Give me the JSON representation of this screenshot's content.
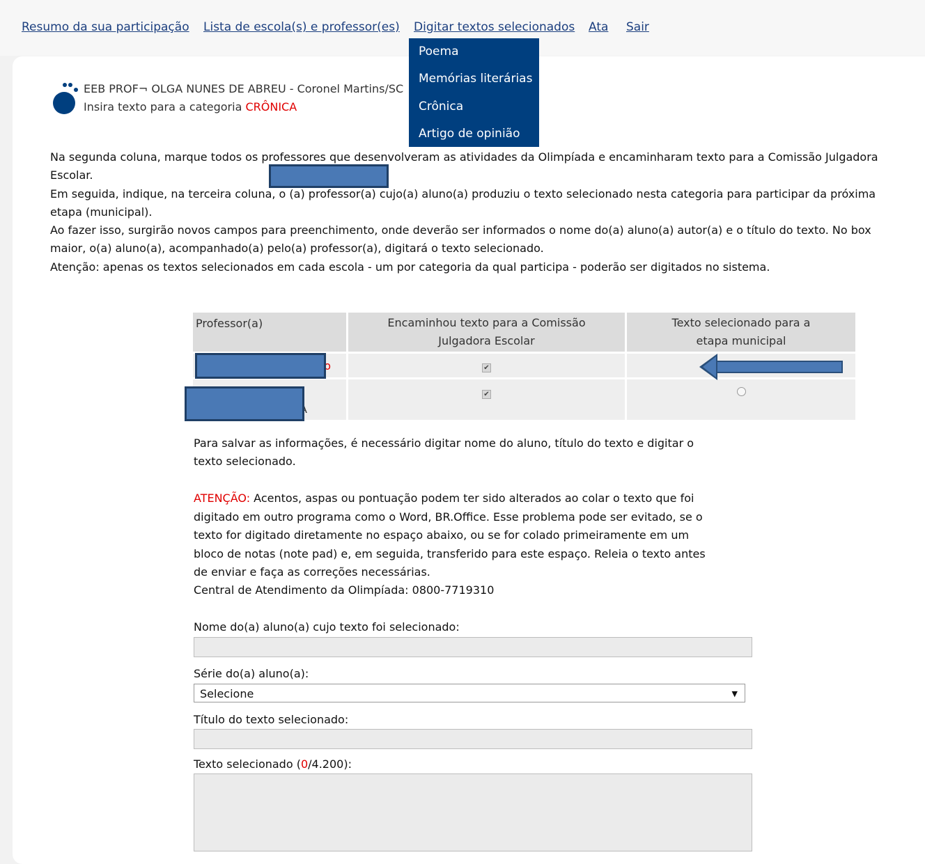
{
  "nav": {
    "items": [
      "Resumo da sua participação",
      "Lista de escola(s) e professor(es)",
      "Digitar textos selecionados",
      "Ata",
      "Sair"
    ]
  },
  "dropdown": {
    "items": [
      "Poema",
      "Memórias literárias",
      "Crônica",
      "Artigo de opinião"
    ]
  },
  "school": {
    "name": "EEB PROF¬ OLGA NUNES DE ABREU - Coronel Martins/SC",
    "insert_prefix": "Insira texto para a categoria",
    "category": "CRÔNICA"
  },
  "instructions": [
    "Na segunda coluna, marque todos os professores que desenvolveram as atividades da Olimpíada e encaminharam texto para a Comissão Julgadora",
    "Escolar.",
    "Em seguida, indique, na terceira coluna, o (a) professor(a) cujo(a) aluno(a) produziu o texto selecionado nesta categoria para participar da próxima",
    "etapa (municipal).",
    "Ao fazer isso, surgirão novos campos para preenchimento, onde deverão ser informados o nome do(a) aluno(a) autor(a) e o título do texto. No box",
    "maior, o(a) aluno(a), acompanhado(a) pelo(a) professor(a), digitará o texto selecionado.",
    "Atenção: apenas os textos selecionados em cada escola - um por categoria da qual participa - poderão ser digitados no sistema."
  ],
  "table": {
    "headers": [
      "Professor(a)",
      "Encaminhou texto para a Comissão Julgadora Escolar",
      "Texto selecionado para a etapa municipal"
    ],
    "rows": [
      {
        "name_tail": "o",
        "sent": true,
        "selected": true
      },
      {
        "name_tail": "A",
        "sent": true,
        "selected": false
      }
    ]
  },
  "notice": {
    "save_line1": "Para salvar as informações, é necessário digitar nome do aluno, título do texto e digitar o",
    "save_line2": "texto selecionado.",
    "attention_label": "ATENÇÃO:",
    "attention_line1": " Acentos, aspas ou pontuação podem ter sido alterados ao colar o texto que foi",
    "attention_line2": "digitado em outro programa como o Word, BR.Office. Esse problema pode ser evitado, se o",
    "attention_line3": "texto for digitado diretamente no espaço abaixo, ou se for colado primeiramente em um",
    "attention_line4": "bloco de notas (note pad) e, em seguida, transferido para este espaço. Releia o texto antes",
    "attention_line5": "de enviar e faça as correções necessárias.",
    "central": "Central de Atendimento da Olimpíada: 0800-7719310"
  },
  "form": {
    "student_label": "Nome do(a) aluno(a) cujo texto foi selecionado:",
    "grade_label": "Série do(a) aluno(a):",
    "grade_value": "Selecione",
    "title_label": "Título do texto selecionado:",
    "text_label_prefix": "Texto selecionado (",
    "text_count": "0",
    "text_label_suffix": "/4.200):"
  },
  "icons": {
    "dropdown_chevron": "chevron-down-icon",
    "checkbox": "check-icon",
    "radio": "radio-icon"
  }
}
